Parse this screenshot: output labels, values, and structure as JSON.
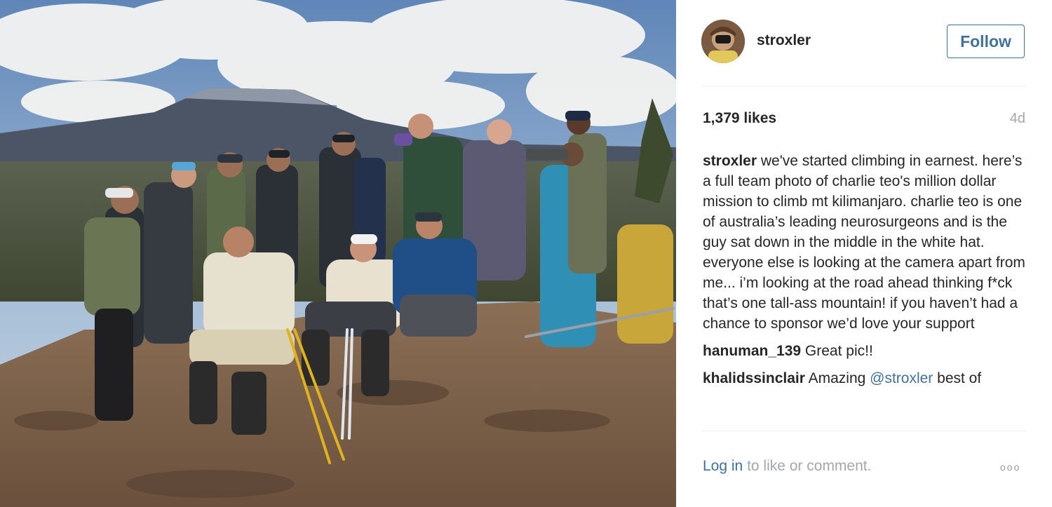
{
  "post": {
    "username": "stroxler",
    "follow_label": "Follow",
    "likes": "1,379 likes",
    "time": "4d"
  },
  "comments": [
    {
      "user": "stroxler",
      "text": "we've started climbing in earnest. here’s a full team photo of charlie teo's million dollar mission to climb mt kilimanjaro. charlie teo is one of australia’s leading neurosurgeons and is the guy sat down in the middle in the white hat. everyone else is looking at the camera apart from me... i’m looking at the road ahead thinking f*ck that’s one tall-ass mountain! if you haven’t had a chance to sponsor we’d love your support"
    },
    {
      "user": "hanuman_139",
      "text": "Great pic!!"
    },
    {
      "user": "khalidssinclair",
      "text_before": "Amazing",
      "mention": "@stroxler",
      "text_after": "best of"
    }
  ],
  "footer": {
    "login": "Log in",
    "rest": "to like or comment.",
    "more": "ooo"
  },
  "colors": {
    "link_blue": "#3f729b",
    "text_dark": "#262626",
    "text_muted": "#a5a7aa"
  }
}
